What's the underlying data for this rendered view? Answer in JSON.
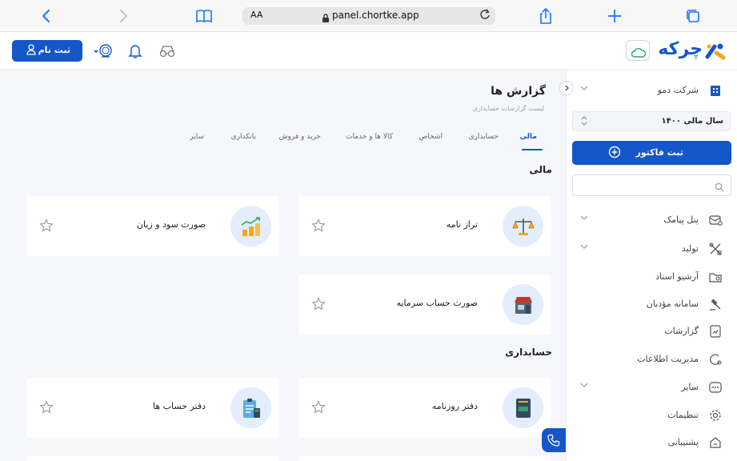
{
  "browser": {
    "reader_label": "AA",
    "url": "panel.chortke.app",
    "icons": [
      "back-icon",
      "forward-icon",
      "bookmarks-icon",
      "lock-icon",
      "reload-icon",
      "share-icon",
      "new-tab-icon",
      "tabs-icon"
    ]
  },
  "topbar": {
    "logo_text": "چرکه",
    "register_label": "ثبت نام",
    "icons": [
      "user-icon",
      "coin-icon",
      "bell-icon",
      "glasses-icon",
      "cloud-icon"
    ]
  },
  "sidebar": {
    "company": "شرکت دمو",
    "fiscal_year": "سال مالی ۱۴۰۰",
    "invoice_button": "ثبت فاکتور",
    "search_placeholder": "",
    "items": [
      {
        "label": "پنل پیامک",
        "icon": "sms-panel-icon",
        "expandable": true
      },
      {
        "label": "تولید",
        "icon": "tools-icon",
        "expandable": true
      },
      {
        "label": "آرشیو اسناد",
        "icon": "folder-icon",
        "expandable": false
      },
      {
        "label": "سامانه مؤدیان",
        "icon": "gavel-icon",
        "expandable": false
      },
      {
        "label": "گزارشات",
        "icon": "report-icon",
        "expandable": false
      },
      {
        "label": "مدیریت اطلاعات",
        "icon": "data-icon",
        "expandable": false
      },
      {
        "label": "سایر",
        "icon": "more-icon",
        "expandable": true
      },
      {
        "label": "تنظیمات",
        "icon": "settings-icon",
        "expandable": false
      },
      {
        "label": "پشتیبانی",
        "icon": "support-icon",
        "expandable": false
      }
    ]
  },
  "main": {
    "title": "گزارش ها",
    "subtitle": "لیست گزارشات حسابداری",
    "tabs": [
      "مالی",
      "حسابداری",
      "اشخاص",
      "کالا ها و خدمات",
      "خرید و فروش",
      "بانکداری",
      "سایر"
    ],
    "active_tab": "مالی",
    "sections": [
      {
        "title": "مالی",
        "cards": [
          {
            "label": "تراز نامه",
            "icon": "balance-scale-icon"
          },
          {
            "label": "صورت سود و زیان",
            "icon": "profit-chart-icon"
          },
          {
            "label": "صورت حساب سرمایه",
            "icon": "store-icon"
          }
        ]
      },
      {
        "title": "حسابداری",
        "cards": [
          {
            "label": "دفتر روزنامه",
            "icon": "journal-book-icon"
          },
          {
            "label": "دفتر حساب ها",
            "icon": "ledger-clipboard-icon"
          }
        ]
      }
    ]
  },
  "colors": {
    "accent": "#1557c8",
    "background": "#f6f7fb",
    "icon_bg": "#e3edfb"
  }
}
